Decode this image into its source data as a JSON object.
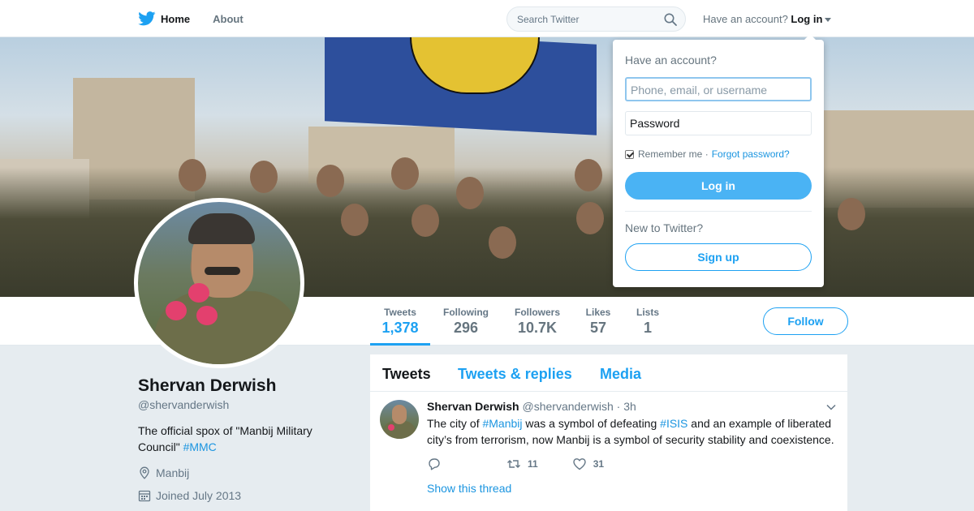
{
  "nav": {
    "home_label": "Home",
    "about_label": "About",
    "search_placeholder": "Search Twitter",
    "have_account_text": "Have an account?",
    "login_label": "Log in"
  },
  "profile": {
    "name": "Shervan Derwish",
    "handle": "@shervanderwish",
    "bio_text": "The official spox of \"Manbij Military Council\"",
    "bio_hashtag": "#MMC",
    "location": "Manbij",
    "joined": "Joined July 2013"
  },
  "stats": [
    {
      "label": "Tweets",
      "value": "1,378",
      "active": true
    },
    {
      "label": "Following",
      "value": "296"
    },
    {
      "label": "Followers",
      "value": "10.7K"
    },
    {
      "label": "Likes",
      "value": "57"
    },
    {
      "label": "Lists",
      "value": "1"
    }
  ],
  "follow_label": "Follow",
  "tabs": [
    "Tweets",
    "Tweets & replies",
    "Media"
  ],
  "tweet": {
    "name": "Shervan Derwish",
    "handle": "@shervanderwish",
    "time": "· 3h",
    "text_1": "The city of ",
    "tag_1": "#Manbij",
    "text_2": " was a symbol of defeating ",
    "tag_2": "#ISIS",
    "text_3": " and an example of liberated city’s from terrorism, now Manbij is a symbol of security stability and coexistence.",
    "retweets": "11",
    "likes": "31",
    "thread_label": "Show this thread"
  },
  "login_dropdown": {
    "title": "Have an account?",
    "username_placeholder": "Phone, email, or username",
    "password_placeholder": "Password",
    "remember_label": "Remember me ·",
    "forgot_label": "Forgot password?",
    "login_button": "Log in",
    "new_text": "New to Twitter?",
    "signup_button": "Sign up"
  },
  "colors": {
    "accent": "#1da1f2",
    "link": "#1b95e0",
    "page_bg": "#e6ecf0"
  }
}
